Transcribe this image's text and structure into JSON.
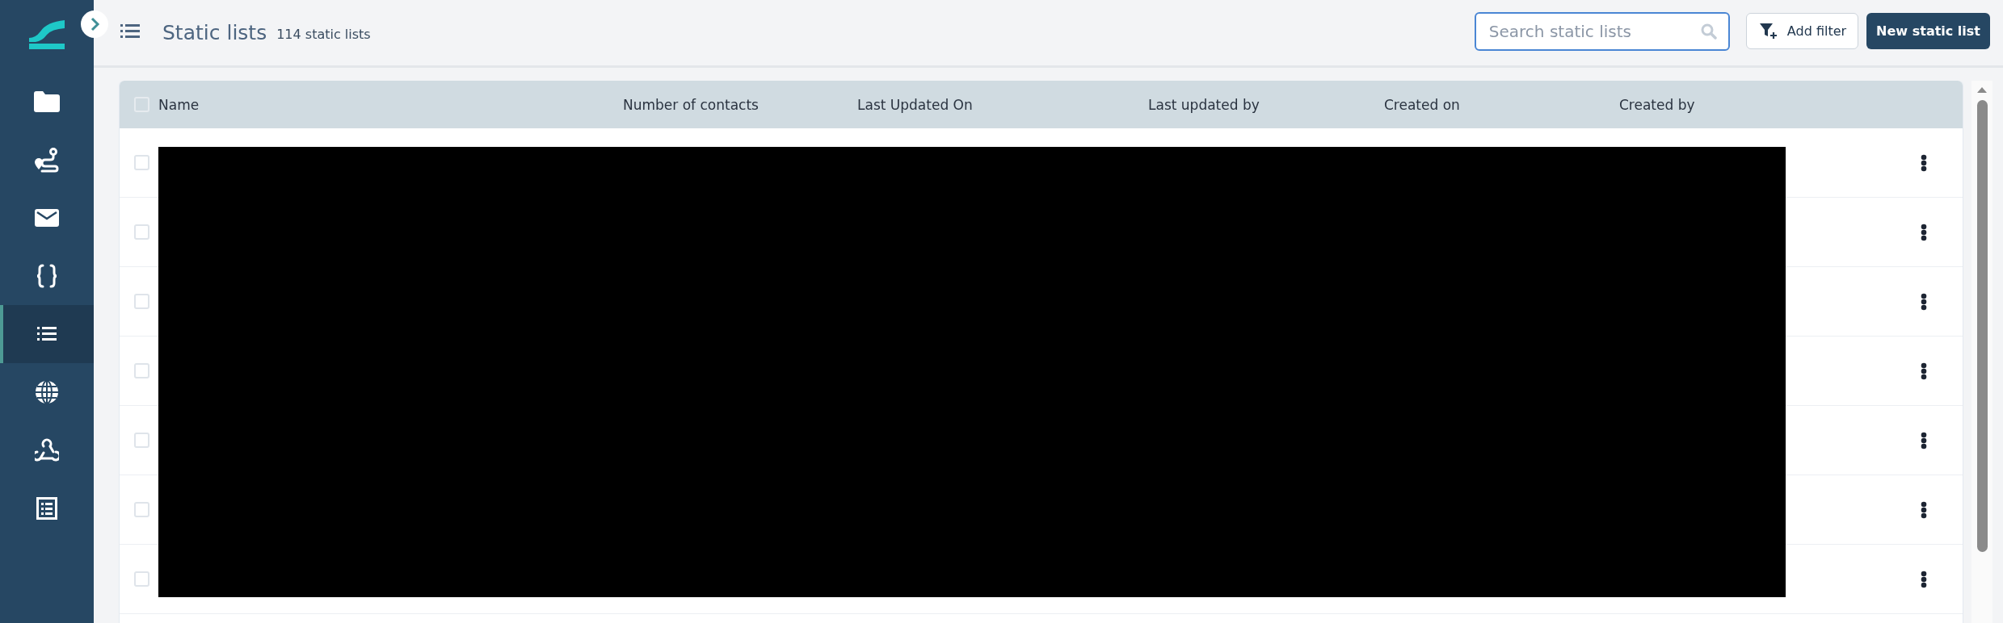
{
  "sidebar": {
    "items": [
      {
        "kind": "folder",
        "selected": false
      },
      {
        "kind": "route",
        "selected": false
      },
      {
        "kind": "mail",
        "selected": false
      },
      {
        "kind": "braces",
        "selected": false
      },
      {
        "kind": "list",
        "selected": true
      },
      {
        "kind": "globe",
        "selected": false
      },
      {
        "kind": "webhook",
        "selected": false
      },
      {
        "kind": "form",
        "selected": false
      }
    ]
  },
  "header": {
    "title": "Static lists",
    "count": "114 static lists",
    "search": {
      "placeholder": "Search static lists"
    },
    "buttons": [
      {
        "kind": "filter",
        "label": "Add filter"
      },
      {
        "kind": "primary",
        "label": "New static list"
      }
    ]
  },
  "table": {
    "columns": [
      "Name",
      "Number of contacts",
      "Last Updated On",
      "Last updated by",
      "Created on",
      "Created by"
    ],
    "header_checkbox": {
      "checked": false
    },
    "rows": [
      {
        "checked": false
      },
      {
        "checked": false
      },
      {
        "checked": false
      },
      {
        "checked": false
      },
      {
        "checked": false
      },
      {
        "checked": false
      },
      {
        "checked": false
      }
    ]
  }
}
